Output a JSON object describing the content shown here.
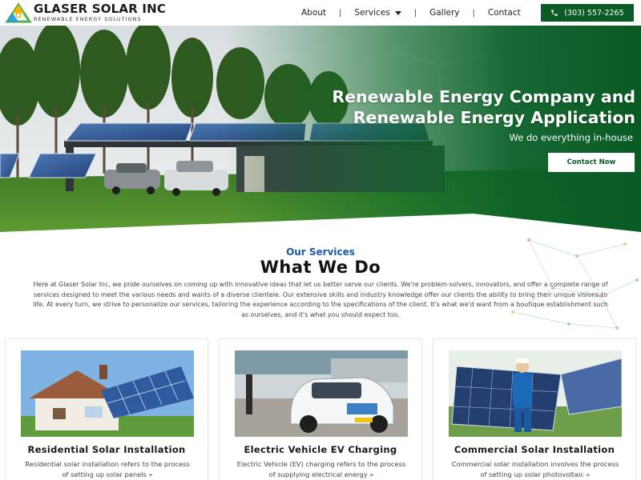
{
  "brand": {
    "title": "GLASER SOLAR INC",
    "subtitle": "RENEWABLE ENERGY SOLUTIONS"
  },
  "nav": {
    "items": [
      {
        "label": "About"
      },
      {
        "label": "Services"
      },
      {
        "label": "Gallery"
      },
      {
        "label": "Contact"
      }
    ],
    "separator": "|"
  },
  "phone": {
    "label": "(303) 557-2265",
    "icon": "phone-icon"
  },
  "hero": {
    "title_line1": "Renewable Energy Company and",
    "title_line2": "Renewable Energy Application",
    "subtitle": "We do everything in-house",
    "cta_label": "Contact Now"
  },
  "services": {
    "eyebrow": "Our Services",
    "title": "What We Do",
    "intro": "Here at Glaser Solar Inc, we pride ourselves on coming up with innovative ideas that let us better serve our clients. We're problem-solvers, innovators, and offer a complete range of services designed to meet the various needs and wants of a diverse clientele. Our extensive skills and industry knowledge offer our clients the ability to bring their unique visions to life. At every turn, we strive to personalize our services, tailoring the experience according to the specifications of the client. It's what we'd want from a boutique establishment such as ourselves, and it's what you should expect too.",
    "cards": [
      {
        "title": "Residential Solar Installation",
        "text": "Residential solar installation refers to the process of setting up solar panels »"
      },
      {
        "title": "Electric Vehicle EV Charging",
        "text": "Electric Vehicle (EV) charging refers to the process of supplying electrical energy »"
      },
      {
        "title": "Commercial Solar Installation",
        "text": "Commercial solar installation involves the process of setting up solar photovoltaic »"
      }
    ]
  },
  "colors": {
    "brand_green": "#0b5c24",
    "accent_blue": "#1b5aa6"
  }
}
